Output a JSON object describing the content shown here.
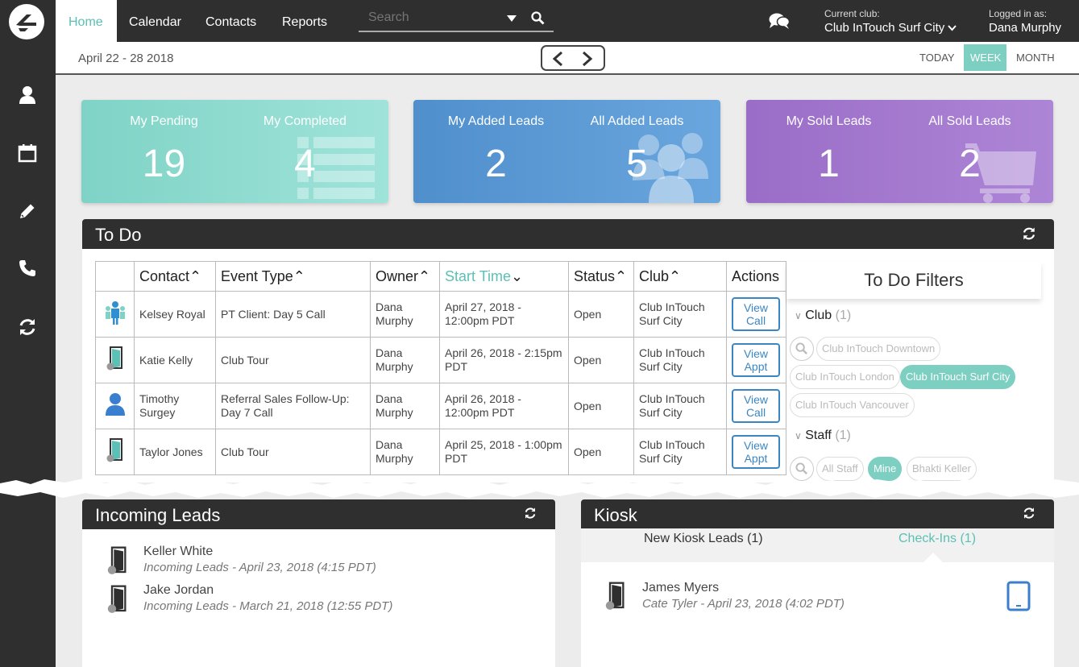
{
  "nav": {
    "tabs": [
      "Home",
      "Calendar",
      "Contacts",
      "Reports"
    ],
    "search_placeholder": "Search",
    "current_club_label": "Current club:",
    "current_club": "Club InTouch Surf City",
    "logged_in_label": "Logged in as:",
    "user": "Dana Murphy"
  },
  "sidebar": {
    "icons": [
      "user-icon",
      "calendar-icon",
      "pencil-icon",
      "phone-icon",
      "sync-icon"
    ]
  },
  "datebar": {
    "range": "April 22 - 28 2018",
    "views": [
      "TODAY",
      "WEEK",
      "MONTH"
    ],
    "active_view": "WEEK"
  },
  "cards": [
    {
      "left_label": "My Pending",
      "left_value": "19",
      "right_label": "My Completed",
      "right_value": "4",
      "color": "#7fd3c6"
    },
    {
      "left_label": "My Added Leads",
      "left_value": "2",
      "right_label": "All Added Leads",
      "right_value": "5",
      "color": "#4f8fcc"
    },
    {
      "left_label": "My Sold Leads",
      "left_value": "1",
      "right_label": "All Sold Leads",
      "right_value": "2",
      "color": "#9a6dc7"
    }
  ],
  "todo": {
    "title": "To Do",
    "headers": [
      "Contact",
      "Event Type",
      "Owner",
      "Start Time",
      "Status",
      "Club",
      "Actions"
    ],
    "rows": [
      {
        "icon": "group-icon",
        "contact": "Kelsey Royal",
        "event": "PT Client: Day 5 Call",
        "owner": "Dana Murphy",
        "start": "April 27, 2018 - 12:00pm PDT",
        "status": "Open",
        "club": "Club InTouch Surf City",
        "action": "View Call"
      },
      {
        "icon": "door-icon",
        "contact": "Katie Kelly",
        "event": "Club Tour",
        "owner": "Dana Murphy",
        "start": "April 26, 2018 - 2:15pm PDT",
        "status": "Open",
        "club": "Club InTouch Surf City",
        "action": "View Appt"
      },
      {
        "icon": "person-icon",
        "contact": "Timothy Surgey",
        "event": "Referral Sales Follow-Up: Day 7 Call",
        "owner": "Dana Murphy",
        "start": "April 26, 2018 - 12:00pm PDT",
        "status": "Open",
        "club": "Club InTouch Surf City",
        "action": "View Call"
      },
      {
        "icon": "door-icon",
        "contact": "Taylor Jones",
        "event": "Club Tour",
        "owner": "Dana Murphy",
        "start": "April 25, 2018 - 1:00pm PDT",
        "status": "Open",
        "club": "Club InTouch Surf City",
        "action": "View Appt"
      }
    ]
  },
  "filters": {
    "title": "To Do Filters",
    "club_label": "Club",
    "club_count": "(1)",
    "clubs": [
      "Club InTouch Downtown",
      "Club InTouch London",
      "Club InTouch Surf City",
      "Club InTouch Vancouver"
    ],
    "selected_club": "Club InTouch Surf City",
    "staff_label": "Staff",
    "staff_count": "(1)",
    "staff": [
      "All Staff",
      "Mine",
      "Bhakti Keller"
    ],
    "selected_staff": "Mine"
  },
  "incoming": {
    "title": "Incoming Leads",
    "items": [
      {
        "name": "Keller White",
        "sub": "Incoming Leads - April 23, 2018 (4:15 PDT)"
      },
      {
        "name": "Jake Jordan",
        "sub": "Incoming Leads - March 21, 2018 (12:55 PDT)"
      }
    ]
  },
  "kiosk": {
    "title": "Kiosk",
    "tabs": [
      "New Kiosk Leads (1)",
      "Check-Ins (1)"
    ],
    "active_tab": "Check-Ins (1)",
    "items": [
      {
        "name": "James Myers",
        "sub": "Cate Tyler - April 23, 2018 (4:02 PDT)"
      }
    ]
  },
  "colors": {
    "accent": "#5bc0b5",
    "link": "#3a86c4",
    "dark": "#2f2f2f"
  }
}
